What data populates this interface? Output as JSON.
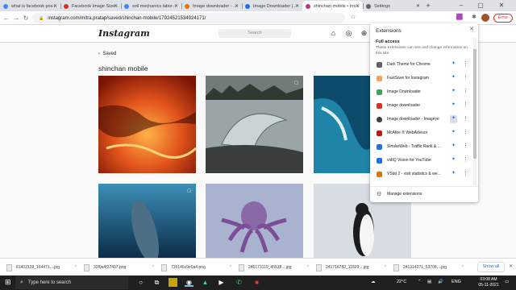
{
  "tabs": [
    {
      "title": "what is facebook pos...",
      "color": "#4285f4"
    },
    {
      "title": "Facebook Image Size...",
      "color": "#d93025"
    },
    {
      "title": "soil mechanics labor...",
      "color": "#4285f4"
    },
    {
      "title": "Image downloader - ...",
      "color": "#e37400"
    },
    {
      "title": "Image Downloader |...",
      "color": "#1a73e8"
    },
    {
      "title": "shinchan mobile • Ins...",
      "color": "#c13584"
    },
    {
      "title": "Settings",
      "color": "#5f6368"
    }
  ],
  "address": {
    "url": "instagram.com/mitra.pratap/saved/shinchan-mobile/17924521534924171/"
  },
  "profile": {
    "button": "Error"
  },
  "instagram": {
    "logo": "Instagram",
    "search_placeholder": "Search",
    "back_label": "Saved",
    "collection_title": "shinchan mobile"
  },
  "posts": [
    {
      "name": "lava-flow-photo"
    },
    {
      "name": "wave-glass-photo"
    },
    {
      "name": "ocean-wave-photo"
    },
    {
      "name": "whale-underwater-photo"
    },
    {
      "name": "octopus-photo"
    },
    {
      "name": "penguin-photo"
    }
  ],
  "extensions_panel": {
    "title": "Extensions",
    "close": "✕",
    "full_access_heading": "Full access",
    "full_access_desc": "These extensions can see and change information on this site.",
    "items": [
      {
        "name": "Dark Theme for Chrome",
        "color": "#5f6368"
      },
      {
        "name": "FastSave for Instagram",
        "color": "#f4a261"
      },
      {
        "name": "Image Downloader",
        "color": "#34a853"
      },
      {
        "name": "Image downloader",
        "color": "#d93025"
      },
      {
        "name": "Image downloader - Imageye",
        "color": "#3c4043"
      },
      {
        "name": "McAfee ® WebAdvisor",
        "color": "#c01818"
      },
      {
        "name": "SimilarWeb - Traffic Rank & ...",
        "color": "#1a73e8"
      },
      {
        "name": "vidIQ Vision for YouTube",
        "color": "#1a73e8"
      },
      {
        "name": "VStat 2 - visit statistics & we...",
        "color": "#e37400"
      }
    ],
    "manage_label": "Manage extensions"
  },
  "downloads": {
    "items": [
      "81402128_164471....jpg",
      "32f0a4f27407.png",
      "735145c9e0a4.png",
      "246173119_45538....jpg",
      "241716782_11829....jpg",
      "241314371_53708....jpg"
    ],
    "show_all": "Show all"
  },
  "taskbar": {
    "search_placeholder": "Type here to search",
    "weather": "22°C",
    "language": "ENG",
    "time": "03:08 AM",
    "date": "05-11-2021"
  }
}
